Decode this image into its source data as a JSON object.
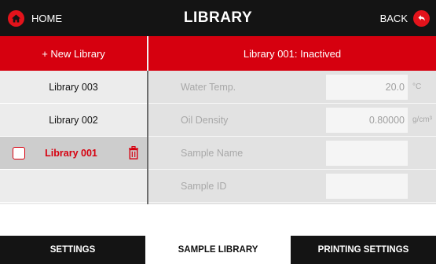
{
  "header": {
    "home_label": "HOME",
    "title": "LIBRARY",
    "back_label": "BACK"
  },
  "toolbar": {
    "new_library_label": "+ New Library",
    "status_text": "Library 001: Inactived"
  },
  "sidebar": {
    "items": [
      {
        "label": "Library 003",
        "selected": false
      },
      {
        "label": "Library 002",
        "selected": false
      },
      {
        "label": "Library 001",
        "selected": true
      }
    ]
  },
  "fields": [
    {
      "label": "Water Temp.",
      "value": "20.0",
      "unit": "°C"
    },
    {
      "label": "Oil Density",
      "value": "0.80000",
      "unit": "g/cm³"
    },
    {
      "label": "Sample Name",
      "value": "",
      "unit": ""
    },
    {
      "label": "Sample ID",
      "value": "",
      "unit": ""
    }
  ],
  "tabs": [
    {
      "label": "SETTINGS",
      "active": false
    },
    {
      "label": "SAMPLE LIBRARY",
      "active": true
    },
    {
      "label": "PRINTING SETTINGS",
      "active": false
    }
  ],
  "colors": {
    "accent": "#d6000f",
    "header_bg": "#141414",
    "sidebar_bg": "#ececec",
    "panel_bg": "#e2e2e2"
  },
  "icons": {
    "home": "home-icon",
    "back": "back-arrow-icon",
    "delete": "trash-icon",
    "select": "checkbox-icon"
  }
}
